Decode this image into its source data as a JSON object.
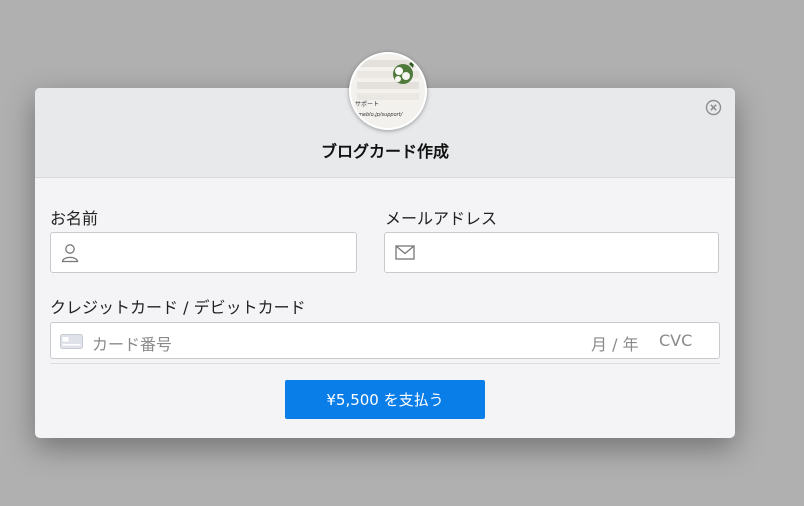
{
  "modal": {
    "title": "ブログカード作成",
    "avatar_text_line1": "サポート",
    "avatar_text_line2": "ameblo.jp/support/"
  },
  "form": {
    "name_label": "お名前",
    "email_label": "メールアドレス",
    "card_label": "クレジットカード / デビットカード",
    "card_number_placeholder": "カード番号",
    "expiry_placeholder": "月 / 年",
    "cvc_placeholder": "CVC"
  },
  "payment": {
    "button_label": "¥5,500 を支払う",
    "button_color": "#0a7ee8"
  },
  "icons": {
    "close": "close-circle-icon",
    "name": "user-icon",
    "email": "envelope-icon",
    "card": "credit-card-icon"
  }
}
